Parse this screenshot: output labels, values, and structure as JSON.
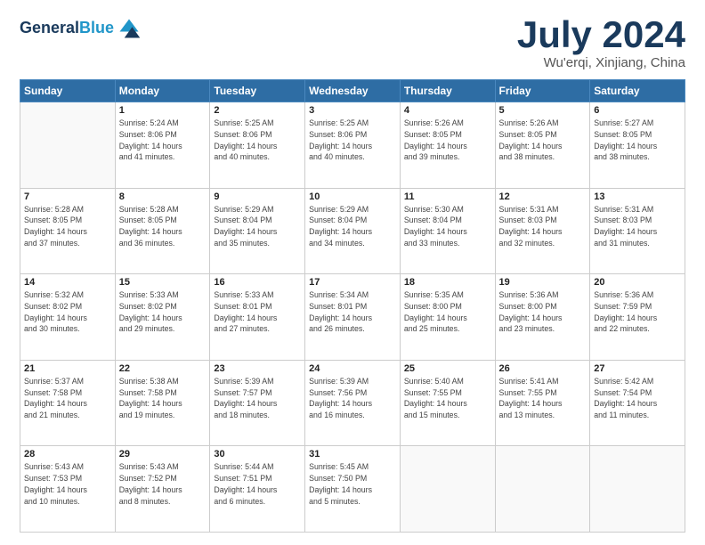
{
  "header": {
    "logo_line1": "General",
    "logo_line2": "Blue",
    "month": "July 2024",
    "location": "Wu'erqi, Xinjiang, China"
  },
  "weekdays": [
    "Sunday",
    "Monday",
    "Tuesday",
    "Wednesday",
    "Thursday",
    "Friday",
    "Saturday"
  ],
  "weeks": [
    [
      {
        "day": "",
        "info": ""
      },
      {
        "day": "1",
        "info": "Sunrise: 5:24 AM\nSunset: 8:06 PM\nDaylight: 14 hours\nand 41 minutes."
      },
      {
        "day": "2",
        "info": "Sunrise: 5:25 AM\nSunset: 8:06 PM\nDaylight: 14 hours\nand 40 minutes."
      },
      {
        "day": "3",
        "info": "Sunrise: 5:25 AM\nSunset: 8:06 PM\nDaylight: 14 hours\nand 40 minutes."
      },
      {
        "day": "4",
        "info": "Sunrise: 5:26 AM\nSunset: 8:05 PM\nDaylight: 14 hours\nand 39 minutes."
      },
      {
        "day": "5",
        "info": "Sunrise: 5:26 AM\nSunset: 8:05 PM\nDaylight: 14 hours\nand 38 minutes."
      },
      {
        "day": "6",
        "info": "Sunrise: 5:27 AM\nSunset: 8:05 PM\nDaylight: 14 hours\nand 38 minutes."
      }
    ],
    [
      {
        "day": "7",
        "info": "Sunrise: 5:28 AM\nSunset: 8:05 PM\nDaylight: 14 hours\nand 37 minutes."
      },
      {
        "day": "8",
        "info": "Sunrise: 5:28 AM\nSunset: 8:05 PM\nDaylight: 14 hours\nand 36 minutes."
      },
      {
        "day": "9",
        "info": "Sunrise: 5:29 AM\nSunset: 8:04 PM\nDaylight: 14 hours\nand 35 minutes."
      },
      {
        "day": "10",
        "info": "Sunrise: 5:29 AM\nSunset: 8:04 PM\nDaylight: 14 hours\nand 34 minutes."
      },
      {
        "day": "11",
        "info": "Sunrise: 5:30 AM\nSunset: 8:04 PM\nDaylight: 14 hours\nand 33 minutes."
      },
      {
        "day": "12",
        "info": "Sunrise: 5:31 AM\nSunset: 8:03 PM\nDaylight: 14 hours\nand 32 minutes."
      },
      {
        "day": "13",
        "info": "Sunrise: 5:31 AM\nSunset: 8:03 PM\nDaylight: 14 hours\nand 31 minutes."
      }
    ],
    [
      {
        "day": "14",
        "info": "Sunrise: 5:32 AM\nSunset: 8:02 PM\nDaylight: 14 hours\nand 30 minutes."
      },
      {
        "day": "15",
        "info": "Sunrise: 5:33 AM\nSunset: 8:02 PM\nDaylight: 14 hours\nand 29 minutes."
      },
      {
        "day": "16",
        "info": "Sunrise: 5:33 AM\nSunset: 8:01 PM\nDaylight: 14 hours\nand 27 minutes."
      },
      {
        "day": "17",
        "info": "Sunrise: 5:34 AM\nSunset: 8:01 PM\nDaylight: 14 hours\nand 26 minutes."
      },
      {
        "day": "18",
        "info": "Sunrise: 5:35 AM\nSunset: 8:00 PM\nDaylight: 14 hours\nand 25 minutes."
      },
      {
        "day": "19",
        "info": "Sunrise: 5:36 AM\nSunset: 8:00 PM\nDaylight: 14 hours\nand 23 minutes."
      },
      {
        "day": "20",
        "info": "Sunrise: 5:36 AM\nSunset: 7:59 PM\nDaylight: 14 hours\nand 22 minutes."
      }
    ],
    [
      {
        "day": "21",
        "info": "Sunrise: 5:37 AM\nSunset: 7:58 PM\nDaylight: 14 hours\nand 21 minutes."
      },
      {
        "day": "22",
        "info": "Sunrise: 5:38 AM\nSunset: 7:58 PM\nDaylight: 14 hours\nand 19 minutes."
      },
      {
        "day": "23",
        "info": "Sunrise: 5:39 AM\nSunset: 7:57 PM\nDaylight: 14 hours\nand 18 minutes."
      },
      {
        "day": "24",
        "info": "Sunrise: 5:39 AM\nSunset: 7:56 PM\nDaylight: 14 hours\nand 16 minutes."
      },
      {
        "day": "25",
        "info": "Sunrise: 5:40 AM\nSunset: 7:55 PM\nDaylight: 14 hours\nand 15 minutes."
      },
      {
        "day": "26",
        "info": "Sunrise: 5:41 AM\nSunset: 7:55 PM\nDaylight: 14 hours\nand 13 minutes."
      },
      {
        "day": "27",
        "info": "Sunrise: 5:42 AM\nSunset: 7:54 PM\nDaylight: 14 hours\nand 11 minutes."
      }
    ],
    [
      {
        "day": "28",
        "info": "Sunrise: 5:43 AM\nSunset: 7:53 PM\nDaylight: 14 hours\nand 10 minutes."
      },
      {
        "day": "29",
        "info": "Sunrise: 5:43 AM\nSunset: 7:52 PM\nDaylight: 14 hours\nand 8 minutes."
      },
      {
        "day": "30",
        "info": "Sunrise: 5:44 AM\nSunset: 7:51 PM\nDaylight: 14 hours\nand 6 minutes."
      },
      {
        "day": "31",
        "info": "Sunrise: 5:45 AM\nSunset: 7:50 PM\nDaylight: 14 hours\nand 5 minutes."
      },
      {
        "day": "",
        "info": ""
      },
      {
        "day": "",
        "info": ""
      },
      {
        "day": "",
        "info": ""
      }
    ]
  ]
}
